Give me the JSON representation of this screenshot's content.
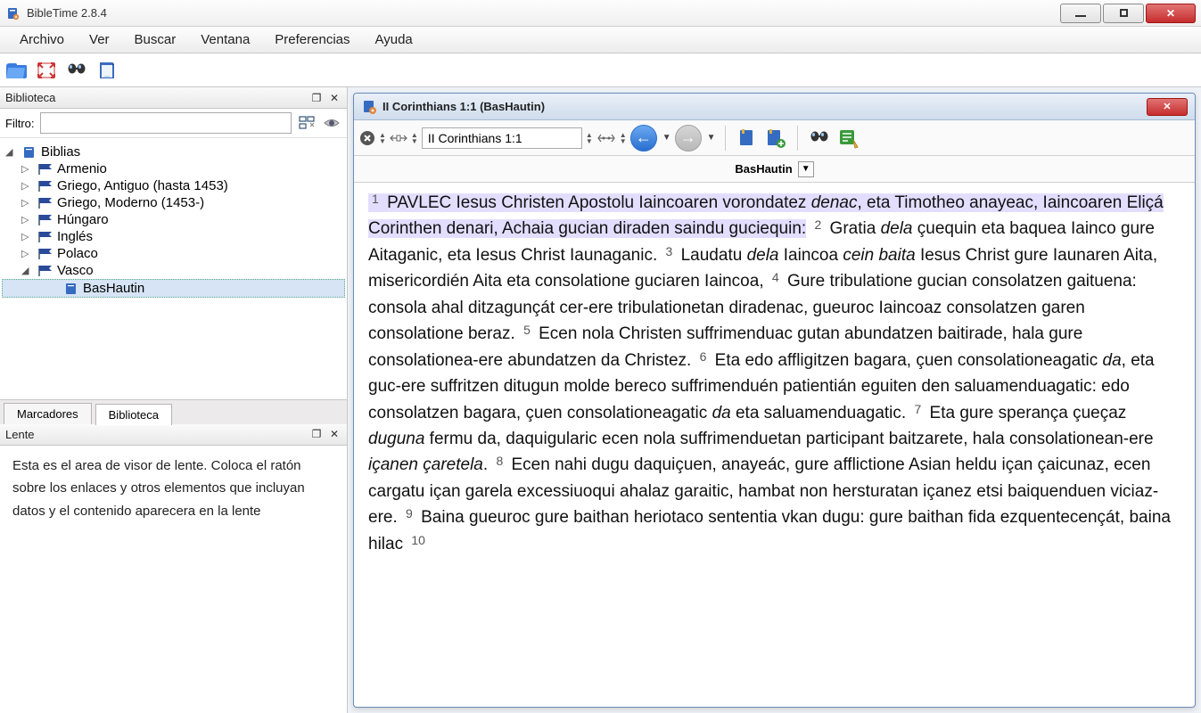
{
  "app": {
    "title": "BibleTime 2.8.4"
  },
  "menu": {
    "items": [
      "Archivo",
      "Ver",
      "Buscar",
      "Ventana",
      "Preferencias",
      "Ayuda"
    ]
  },
  "sidebar": {
    "title": "Biblioteca",
    "filter_label": "Filtro:",
    "filter_value": "",
    "root": "Biblias",
    "langs": [
      "Armenio",
      "Griego, Antiguo (hasta 1453)",
      "Griego, Moderno (1453-)",
      "Húngaro",
      "Inglés",
      "Polaco",
      "Vasco"
    ],
    "selected_work": "BasHautin",
    "tabs": [
      "Marcadores",
      "Biblioteca"
    ],
    "active_tab": 1
  },
  "lens": {
    "title": "Lente",
    "text": "Esta es el area de visor de lente. Coloca el ratón sobre los enlaces y otros elementos que incluyan datos y el contenido aparecera en la lente"
  },
  "reader": {
    "title": "II Corinthians 1:1 (BasHautin)",
    "location": "II Corinthians 1:1",
    "version": "BasHautin"
  },
  "verses": [
    {
      "n": "1",
      "hl": true,
      "t": "PAVLEC Iesus Christen Apostolu Iaincoaren vorondatez <em>denac</em>, eta Timotheo anayeac, Iaincoaren Eliçá Corinthen denari, Achaia gucian diraden saindu guciequin:"
    },
    {
      "n": "2",
      "t": "Gratia <em>dela</em> çuequin eta baquea Iainco gure Aitaganic, eta Iesus Christ Iaunaganic."
    },
    {
      "n": "3",
      "t": "Laudatu <em>dela</em> Iaincoa <em>cein baita</em> Iesus Christ gure Iaunaren Aita, misericordién Aita eta consolatione guciaren Iaincoa,"
    },
    {
      "n": "4",
      "t": "Gure tribulatione gucian consolatzen gaituena: consola ahal ditzagunçát cer-ere tribulationetan diradenac, gueuroc Iaincoaz consolatzen garen consolatione beraz."
    },
    {
      "n": "5",
      "t": "Ecen nola Christen suffrimenduac gutan abundatzen baitirade, hala gure consolationea-ere abundatzen da Christez."
    },
    {
      "n": "6",
      "t": "Eta edo affligitzen bagara, çuen consolationeagatic <em>da</em>, eta guc-ere suffritzen ditugun molde bereco suffrimenduén patientián eguiten den saluamenduagatic: edo consolatzen bagara, çuen consolationeagatic <em>da</em> eta saluamenduagatic."
    },
    {
      "n": "7",
      "t": "Eta gure sperança çueçaz <em>duguna</em> fermu da, daquigularic ecen nola suffrimenduetan participant baitzarete, hala consolationean-ere <em>içanen çaretela</em>."
    },
    {
      "n": "8",
      "t": "Ecen nahi dugu daquiçuen, anayeác, gure afflictione Asian heldu içan çaicunaz, ecen cargatu içan garela excessiuoqui ahalaz garaitic, hambat non hersturatan içanez etsi baiquenduen viciaz-ere."
    },
    {
      "n": "9",
      "t": "Baina gueuroc gure baithan heriotaco sententia vkan dugu: gure baithan fida ezquentecençát, baina hilac"
    },
    {
      "n": "10",
      "t": ""
    }
  ]
}
